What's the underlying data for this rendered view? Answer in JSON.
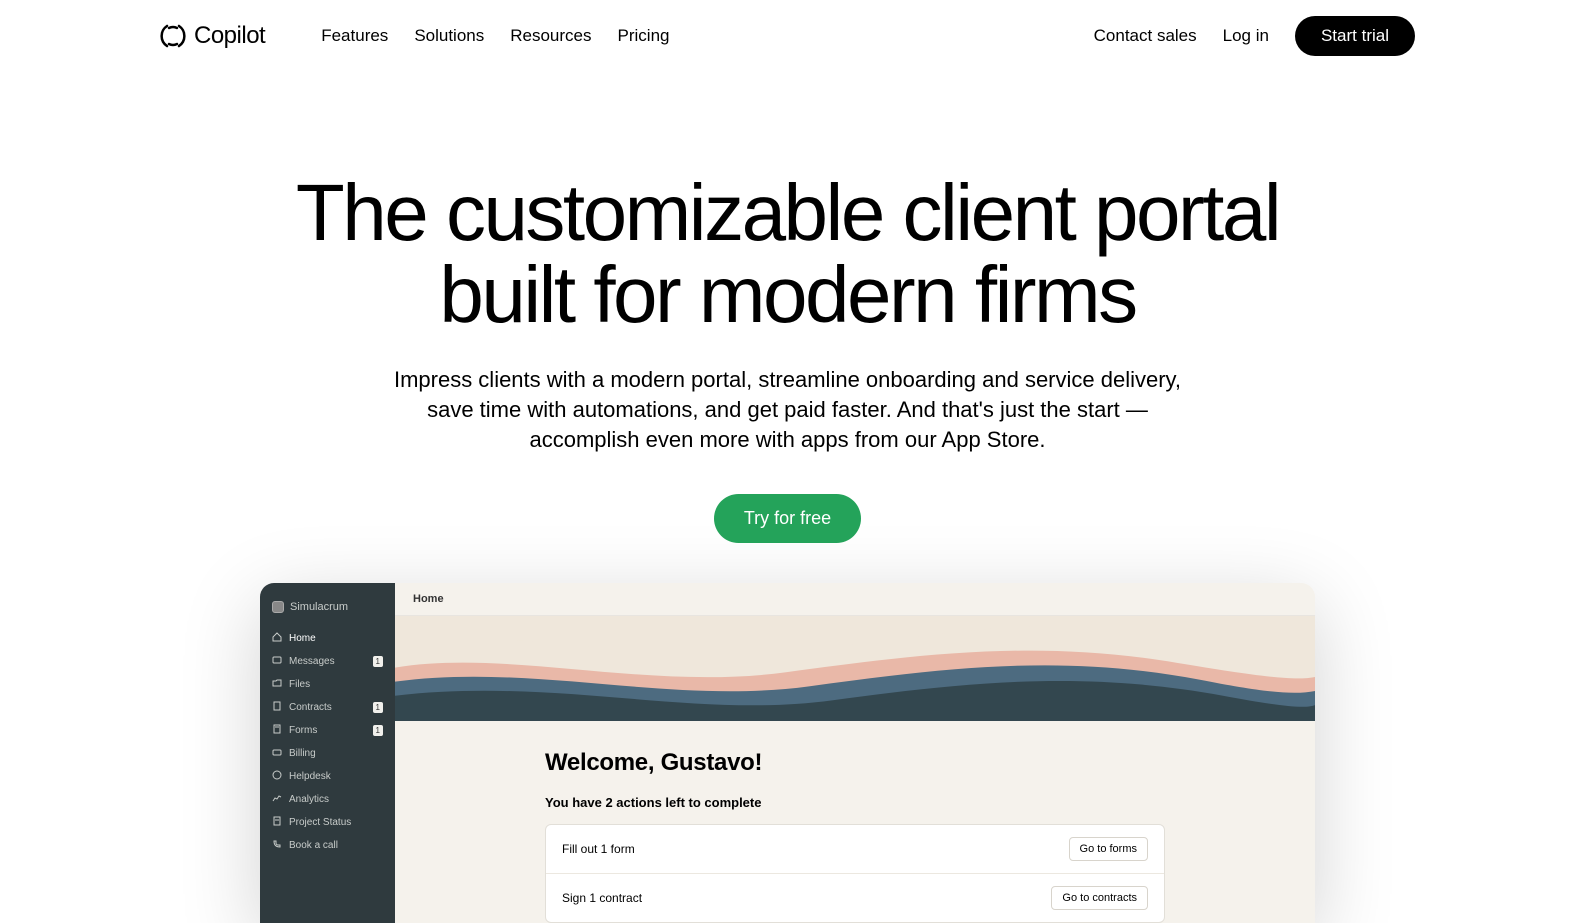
{
  "brand": "Copilot",
  "nav": {
    "links": [
      "Features",
      "Solutions",
      "Resources",
      "Pricing"
    ],
    "contact": "Contact sales",
    "login": "Log in",
    "trial": "Start trial"
  },
  "hero": {
    "title": "The customizable client portal built for modern firms",
    "subtitle": "Impress clients with a modern portal, streamline onboarding and service delivery, save time with automations, and get paid faster. And that's just the start — accomplish even more with apps from our App Store.",
    "cta": "Try for free"
  },
  "mockup": {
    "workspace": "Simulacrum",
    "topbar": "Home",
    "sidebar": [
      {
        "label": "Home",
        "badge": null
      },
      {
        "label": "Messages",
        "badge": "1"
      },
      {
        "label": "Files",
        "badge": null
      },
      {
        "label": "Contracts",
        "badge": "1"
      },
      {
        "label": "Forms",
        "badge": "1"
      },
      {
        "label": "Billing",
        "badge": null
      },
      {
        "label": "Helpdesk",
        "badge": null
      },
      {
        "label": "Analytics",
        "badge": null
      },
      {
        "label": "Project Status",
        "badge": null
      },
      {
        "label": "Book a call",
        "badge": null
      }
    ],
    "welcome": "Welcome, Gustavo!",
    "actions_heading": "You have 2 actions left to complete",
    "actions": [
      {
        "text": "Fill out 1 form",
        "button": "Go to forms"
      },
      {
        "text": "Sign 1 contract",
        "button": "Go to contracts"
      }
    ]
  }
}
